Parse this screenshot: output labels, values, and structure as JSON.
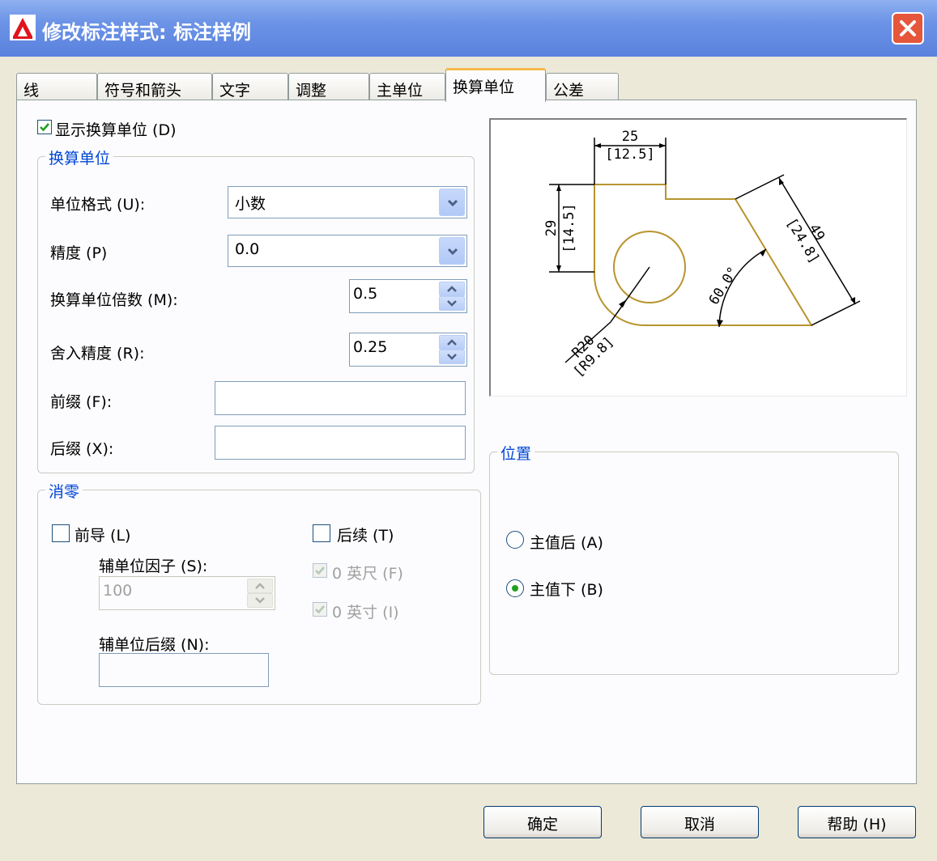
{
  "window": {
    "title": "修改标注样式: 标注样例",
    "colors": {
      "title_bar": "#6b93e6",
      "face": "#ece9d8",
      "group_title": "#0046d5",
      "preview_geometry": "#b8942e",
      "tab_highlight": "#f4b84a"
    }
  },
  "tabs": [
    {
      "label": "线",
      "active": false
    },
    {
      "label": "符号和箭头",
      "active": false
    },
    {
      "label": "文字",
      "active": false
    },
    {
      "label": "调整",
      "active": false
    },
    {
      "label": "主单位",
      "active": false
    },
    {
      "label": "换算单位",
      "active": true
    },
    {
      "label": "公差",
      "active": false
    }
  ],
  "show_alt_units": {
    "label": "显示换算单位 (D)",
    "checked": true
  },
  "alt_units_group": {
    "title": "换算单位",
    "unit_format": {
      "label": "单位格式 (U):",
      "value": "小数"
    },
    "precision": {
      "label": "精度 (P)",
      "value": "0.0"
    },
    "multiplier": {
      "label": "换算单位倍数 (M):",
      "value": "0.5"
    },
    "round_off": {
      "label": "舍入精度 (R):",
      "value": "0.25"
    },
    "prefix": {
      "label": "前缀 (F):",
      "value": ""
    },
    "suffix": {
      "label": "后缀 (X):",
      "value": ""
    }
  },
  "zero_suppression": {
    "title": "消零",
    "leading": {
      "label": "前导 (L)",
      "checked": false
    },
    "sub_unit_factor": {
      "label": "辅单位因子 (S):",
      "value": "100"
    },
    "sub_unit_suffix": {
      "label": "辅单位后缀 (N):",
      "value": ""
    },
    "trailing": {
      "label": "后续 (T)",
      "checked": false
    },
    "zero_feet": {
      "label": "0 英尺 (F)",
      "checked": true,
      "enabled": false
    },
    "zero_inches": {
      "label": "0 英寸 (I)",
      "checked": true,
      "enabled": false
    }
  },
  "preview": {
    "dim_top": "25",
    "dim_top_alt": "[12.5]",
    "dim_left": "29",
    "dim_left_alt": "[14.5]",
    "dim_right": "49",
    "dim_right_alt": "[24.8]",
    "dim_angle": "60.0°",
    "dim_radius": "R20",
    "dim_radius_alt": "[R9.8]"
  },
  "placement": {
    "title": "位置",
    "after_primary": {
      "label": "主值后 (A)",
      "selected": false
    },
    "below_primary": {
      "label": "主值下 (B)",
      "selected": true
    }
  },
  "buttons": {
    "ok": "确定",
    "cancel": "取消",
    "help": "帮助 (H)"
  }
}
